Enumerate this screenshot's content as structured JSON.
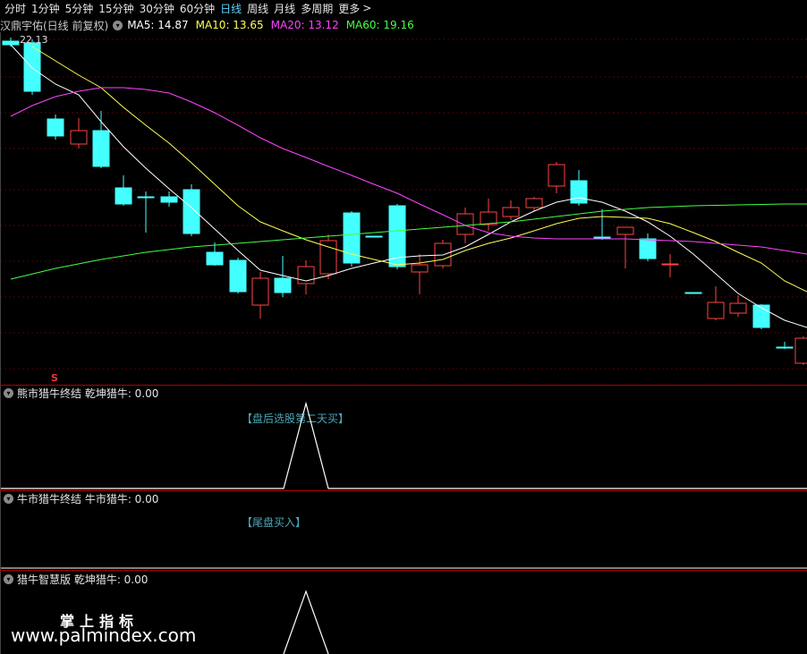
{
  "toolbar": {
    "items": [
      "分时",
      "1分钟",
      "5分钟",
      "15分钟",
      "30分钟",
      "60分钟",
      "日线",
      "周线",
      "月线",
      "多周期",
      "更多"
    ],
    "active_index": 6,
    "more_arrow": ">"
  },
  "main_chart": {
    "stock_title": "汉鼎宇佑(日线 前复权)",
    "ma": [
      {
        "label": "MA5: 14.87",
        "color": "#ffffff"
      },
      {
        "label": "MA10: 13.65",
        "color": "#ffff55"
      },
      {
        "label": "MA20: 13.12",
        "color": "#ff44ff"
      },
      {
        "label": "MA60: 19.16",
        "color": "#44ff44"
      }
    ],
    "high_label": "22.13",
    "signal_mark": "S"
  },
  "panel1": {
    "title": "熊市猎牛终结  乾坤猎牛: 0.00",
    "banner": "【盘后选股第二天买】"
  },
  "panel2": {
    "title": "牛市猎牛终结  牛市猎牛: 0.00",
    "banner": "【尾盘买入】"
  },
  "panel3": {
    "title": "猎牛智慧版  乾坤猎牛: 0.00"
  },
  "watermark": {
    "line1": "掌上指标",
    "line2": "www.palmindex.com"
  },
  "colors": {
    "up": "#ff4444",
    "down": "#44ffff",
    "ma5": "#ffffff",
    "ma10": "#ffff55",
    "ma20": "#ff44ff",
    "ma60": "#44ff44",
    "grid": "#5a0000",
    "separator": "#b00000"
  }
}
